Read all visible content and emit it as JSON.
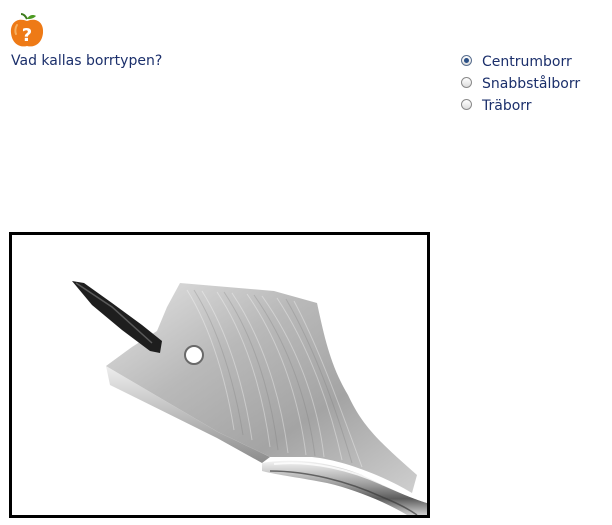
{
  "quiz": {
    "icon": "orange-question-icon",
    "question": "Vad kallas borrtypen?",
    "options": [
      {
        "label": "Centrumborr",
        "selected": true
      },
      {
        "label": "Snabbstålborr",
        "selected": false
      },
      {
        "label": "Träborr",
        "selected": false
      }
    ],
    "image": "spade-drill-bit-photo"
  },
  "colors": {
    "text": "#1b2f6b",
    "icon_orange": "#ee7a16",
    "frame": "#000000"
  }
}
